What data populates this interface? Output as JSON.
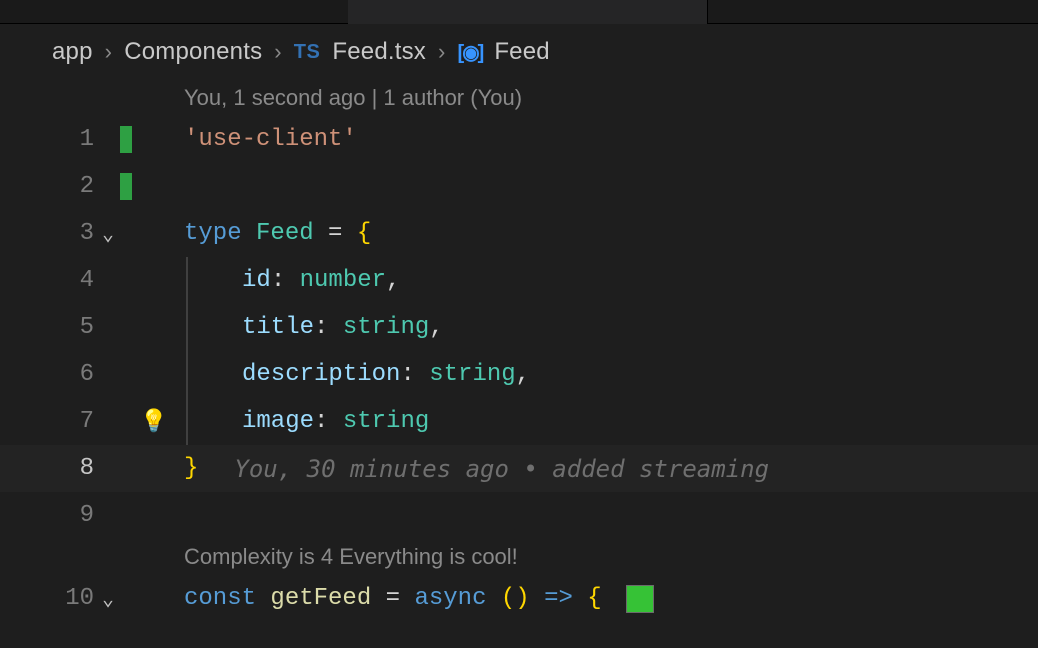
{
  "breadcrumb": {
    "items": [
      "app",
      "Components"
    ],
    "ts_badge": "TS",
    "file": "Feed.tsx",
    "symbol": "Feed"
  },
  "blame_top": "You, 1 second ago | 1 author (You)",
  "codelens": "Complexity is 4 Everything is cool!",
  "lines": {
    "l1": {
      "num": "1",
      "string": "'use-client'"
    },
    "l2": {
      "num": "2"
    },
    "l3": {
      "num": "3",
      "kw": "type",
      "name": "Feed",
      "eq": " = ",
      "brace": "{"
    },
    "l4": {
      "num": "4",
      "prop": "id",
      "colon": ": ",
      "ptype": "number",
      "comma": ","
    },
    "l5": {
      "num": "5",
      "prop": "title",
      "colon": ": ",
      "ptype": "string",
      "comma": ","
    },
    "l6": {
      "num": "6",
      "prop": "description",
      "colon": ": ",
      "ptype": "string",
      "comma": ","
    },
    "l7": {
      "num": "7",
      "prop": "image",
      "colon": ": ",
      "ptype": "string"
    },
    "l8": {
      "num": "8",
      "brace": "}",
      "blame": "You, 30 minutes ago • added streaming"
    },
    "l9": {
      "num": "9"
    },
    "l10": {
      "num": "10",
      "kw": "const",
      "name": "getFeed",
      "eq": " = ",
      "async": "async",
      "arrow": " () ",
      "arrow2": "=>",
      "brace": " { "
    }
  },
  "icons": {
    "bulb": "💡"
  }
}
